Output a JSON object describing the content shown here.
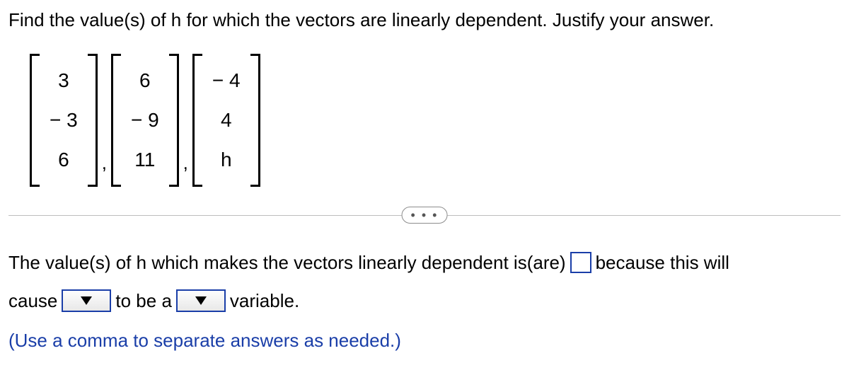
{
  "question": "Find the value(s) of h for which the vectors are linearly dependent. Justify your answer.",
  "vectors": {
    "v1": {
      "r1": "3",
      "r2": "− 3",
      "r3": "6"
    },
    "v2": {
      "r1": "6",
      "r2": "− 9",
      "r3": "11"
    },
    "v3": {
      "r1": "− 4",
      "r2": "4",
      "r3": "h"
    }
  },
  "sep": ",",
  "more": "• • •",
  "answer": {
    "part1a": "The value(s) of h which makes the vectors linearly dependent is(are)",
    "part1b": "because this will",
    "part2a": "cause",
    "part2b": "to be a",
    "part2c": "variable.",
    "hint": "(Use a comma to separate answers as needed.)"
  }
}
